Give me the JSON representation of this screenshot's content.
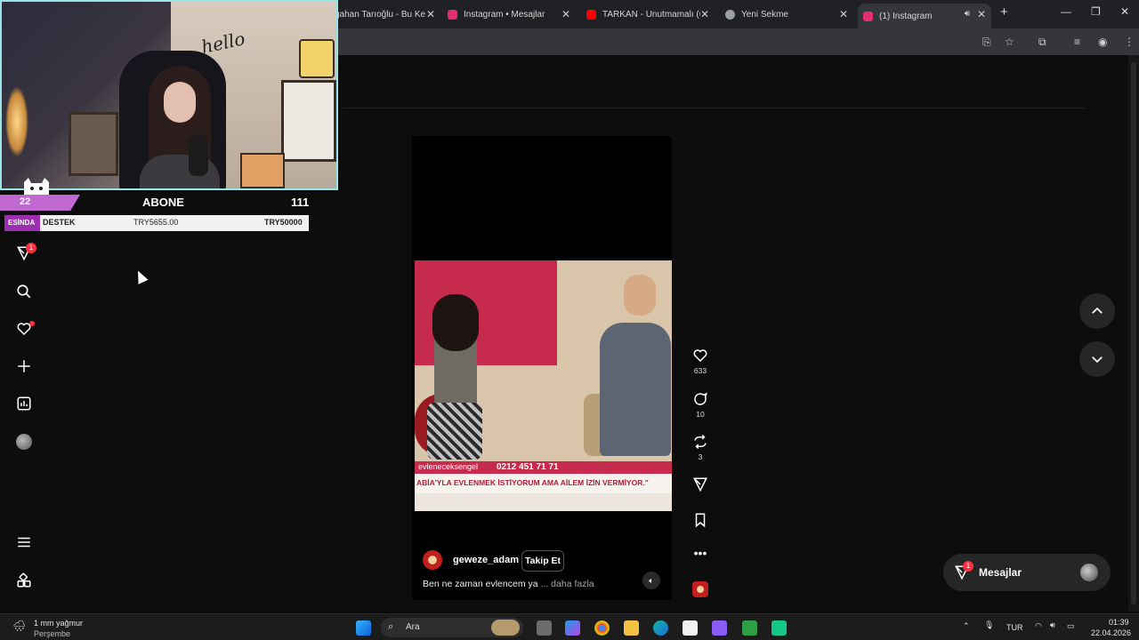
{
  "browser": {
    "tabs": [
      {
        "title": "gahan Tarıoğlu - Bu Ke",
        "favicon_color": "#ffffff"
      },
      {
        "title": "Instagram • Mesajlar",
        "favicon_color": "#e1306c"
      },
      {
        "title": "TARKAN - Unutmamalı (C",
        "favicon_color": "#ff0000"
      },
      {
        "title": "Yeni Sekme",
        "favicon_color": "#9aa0a6"
      },
      {
        "title": "(1) Instagram",
        "favicon_color": "#e1306c"
      }
    ],
    "new_tab": "+"
  },
  "stream_overlay": {
    "hello_text": "hello",
    "sub_count_left": "22",
    "sub_label": "ABONE",
    "sub_count_right": "111",
    "donation_tag": "ESİNDA",
    "donation_label": "DESTEK",
    "donation_current": "TRY5655.00",
    "donation_goal": "TRY50000"
  },
  "sidebar": {
    "notifications_badge": "1"
  },
  "reel": {
    "ticker": "evleneceksengel",
    "phone": "0212 451 71 71",
    "caption_banner": "ABİA'YLA EVLENMEK İSTİYORUM AMA AİLEM İZİN VERMİYOR.\"",
    "author": "geweze_adam",
    "follow_label": "Takip Et",
    "description": "Ben ne zaman evlencem ya",
    "more_label": "... daha fazla",
    "likes": "633",
    "comments": "10",
    "reposts": "3"
  },
  "messages": {
    "label": "Mesajlar",
    "badge": "1"
  },
  "taskbar": {
    "weather_temp": "1 mm yağmur",
    "weather_day": "Perşembe",
    "search_placeholder": "Ara",
    "language": "TUR",
    "time": "01:39",
    "date": "22.04.2026"
  }
}
